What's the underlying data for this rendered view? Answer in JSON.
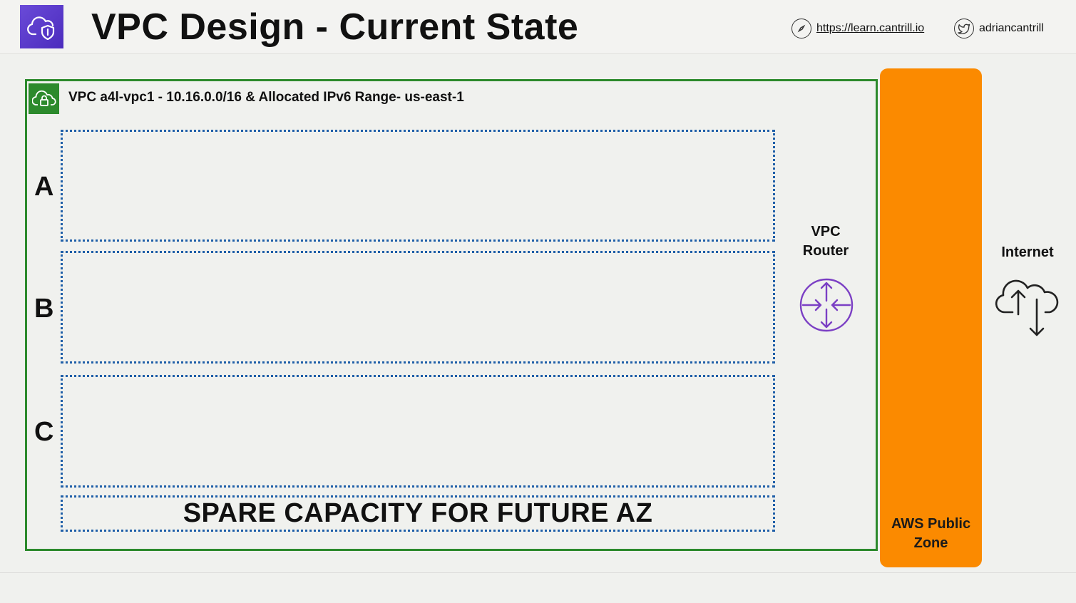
{
  "header": {
    "title": "VPC Design - Current State",
    "url": "https://learn.cantrill.io",
    "handle": "adriancantrill",
    "logo_icon": "cloud-shield-icon"
  },
  "vpc": {
    "label": "VPC a4l-vpc1 - 10.16.0.0/16 & Allocated IPv6 Range- us-east-1",
    "border_color": "#2c8a2c",
    "icon": "vpc-cloud-lock-icon"
  },
  "availability_zones": [
    {
      "letter": "A"
    },
    {
      "letter": "B"
    },
    {
      "letter": "C"
    }
  ],
  "spare_capacity": "SPARE CAPACITY FOR FUTURE AZ",
  "router": {
    "line1": "VPC",
    "line2": "Router",
    "icon": "router-icon",
    "color": "#7b3fc4"
  },
  "public_zone": {
    "line1": "AWS Public",
    "line2": "Zone",
    "color": "#fb8a00"
  },
  "internet": {
    "label": "Internet",
    "icon": "cloud-upload-download-icon"
  }
}
